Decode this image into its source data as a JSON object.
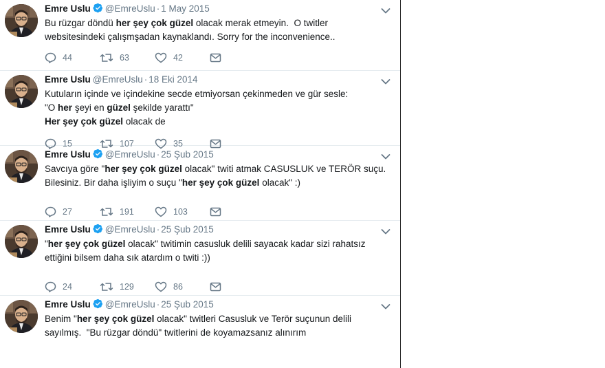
{
  "tweets": [
    {
      "name": "Emre Uslu",
      "verified": true,
      "handle": "@EmreUslu",
      "separator": "·",
      "date": "1 May 2015",
      "text_segments": [
        {
          "t": "Bu rüzgar döndü ",
          "b": false
        },
        {
          "t": "her şey çok güzel",
          "b": true
        },
        {
          "t": " olacak merak etmeyin.  O twitler\nwebsitesindeki çalışmşadan kaynaklandı. Sorry for the inconvenience..",
          "b": false
        }
      ],
      "replies": "44",
      "retweets": "63",
      "likes": "42"
    },
    {
      "name": "Emre Uslu",
      "verified": false,
      "handle": "@EmreUslu",
      "separator": "·",
      "date": "18 Eki 2014",
      "text_segments": [
        {
          "t": "Kutuların içinde ve içindekine secde etmiyorsan çekinmeden ve gür sesle:\n\"O ",
          "b": false
        },
        {
          "t": "her",
          "b": true
        },
        {
          "t": " şeyi en ",
          "b": false
        },
        {
          "t": "güzel",
          "b": true
        },
        {
          "t": " şekilde yarattı\"\n",
          "b": false
        },
        {
          "t": "Her şey çok güzel",
          "b": true
        },
        {
          "t": " olacak de",
          "b": false
        }
      ],
      "replies": "15",
      "retweets": "107",
      "likes": "35"
    },
    {
      "name": "Emre Uslu",
      "verified": true,
      "handle": "@EmreUslu",
      "separator": "·",
      "date": "25 Şub 2015",
      "text_segments": [
        {
          "t": "Savcıya göre \"",
          "b": false
        },
        {
          "t": "her şey çok güzel",
          "b": true
        },
        {
          "t": " olacak\" twiti atmak CASUSLUK ve TERÖR suçu.\nBilesiniz. Bir daha işliyim o suçu \"",
          "b": false
        },
        {
          "t": "her şey çok güzel",
          "b": true
        },
        {
          "t": " olacak\" :)",
          "b": false
        }
      ],
      "replies": "27",
      "retweets": "191",
      "likes": "103"
    },
    {
      "name": "Emre Uslu",
      "verified": true,
      "handle": "@EmreUslu",
      "separator": "·",
      "date": "25 Şub 2015",
      "text_segments": [
        {
          "t": "\"",
          "b": false
        },
        {
          "t": "her şey çok güzel",
          "b": true
        },
        {
          "t": " olacak\" twitimin casusluk delili sayacak kadar sizi rahatsız\nettiğini bilsem daha sık atardım o twiti :))",
          "b": false
        }
      ],
      "replies": "24",
      "retweets": "129",
      "likes": "86"
    },
    {
      "name": "Emre Uslu",
      "verified": true,
      "handle": "@EmreUslu",
      "separator": "·",
      "date": "25 Şub 2015",
      "text_segments": [
        {
          "t": "Benim \"",
          "b": false
        },
        {
          "t": "her şey çok güzel",
          "b": true
        },
        {
          "t": " olacak\" twitleri Casusluk ve Terör suçunun delili\nsayılmış.  \"Bu rüzgar döndü\" twitlerini de koyamazsanız alınırım",
          "b": false
        }
      ],
      "replies": "",
      "retweets": "",
      "likes": ""
    }
  ],
  "icons": {
    "reply": "reply-icon",
    "retweet": "retweet-icon",
    "like": "heart-icon",
    "dm": "envelope-icon",
    "caret": "chevron-down-icon",
    "verified": "verified-badge-icon"
  },
  "colors": {
    "text": "#14171a",
    "secondary": "#657786",
    "verified": "#1da1f2",
    "divider": "#e6ecf0"
  }
}
